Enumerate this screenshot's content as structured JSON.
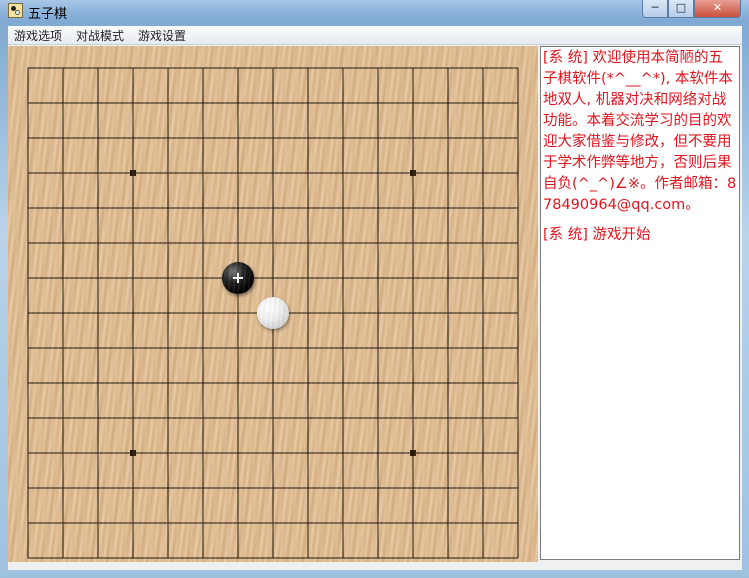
{
  "window": {
    "title": "五子棋",
    "min_label": "─",
    "max_label": "□",
    "close_label": "✕"
  },
  "menu": [
    "游戏选项",
    "对战模式",
    "游戏设置"
  ],
  "board": {
    "stones": [
      {
        "color": "black",
        "col": 6,
        "row": 6,
        "last_move": true
      },
      {
        "color": "white",
        "col": 7,
        "row": 7,
        "last_move": false
      }
    ],
    "last_move_marker": "+"
  },
  "chat": {
    "messages": [
      "[系 统] 欢迎使用本简陋的五子棋软件(*^__^*), 本软件本地双人, 机器对决和网络对战功能。本着交流学习的目的欢迎大家借鉴与修改，但不要用于学术作弊等地方，否则后果自负(^_^)∠※。作者邮箱：878490964@qq.com。",
      "[系 统] 游戏开始"
    ],
    "text_color": "#e0141e"
  }
}
